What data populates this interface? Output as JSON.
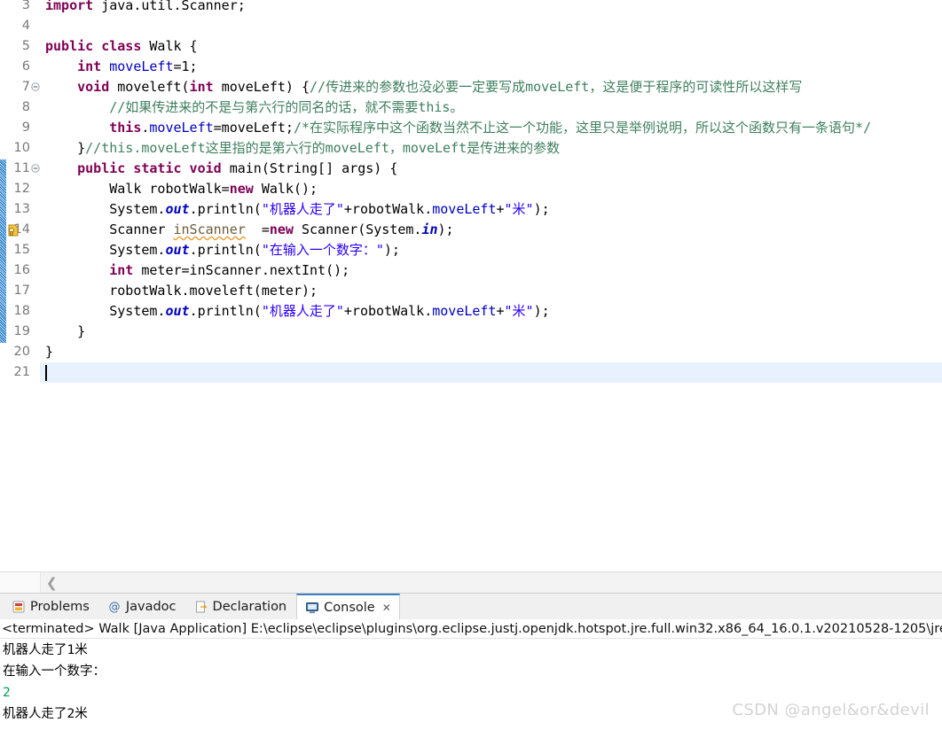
{
  "editor": {
    "first_visible_line": 3,
    "current_line": 21,
    "change_bar": {
      "from_line": 11,
      "to_line": 19,
      "color": "#3a8fd0"
    },
    "warning_marker_line": 14,
    "fold_lines": [
      7,
      11
    ],
    "bottom_scroll_icon": "chevron-left-icon",
    "lines": [
      {
        "n": 3,
        "tokens": [
          {
            "t": "import ",
            "c": "kw"
          },
          {
            "t": "java.util.Scanner;",
            "c": "pln"
          }
        ]
      },
      {
        "n": 4,
        "tokens": []
      },
      {
        "n": 5,
        "tokens": [
          {
            "t": "public class ",
            "c": "kw"
          },
          {
            "t": "Walk {",
            "c": "pln"
          }
        ]
      },
      {
        "n": 6,
        "tokens": [
          {
            "t": "    ",
            "c": "pln"
          },
          {
            "t": "int ",
            "c": "kw"
          },
          {
            "t": "moveLeft",
            "c": "fld"
          },
          {
            "t": "=1;",
            "c": "pln"
          }
        ]
      },
      {
        "n": 7,
        "tokens": [
          {
            "t": "    ",
            "c": "pln"
          },
          {
            "t": "void ",
            "c": "kw"
          },
          {
            "t": "moveleft(",
            "c": "pln"
          },
          {
            "t": "int ",
            "c": "kw"
          },
          {
            "t": "moveLeft) {",
            "c": "pln"
          },
          {
            "t": "//传进来的参数也没必要一定要写成moveLeft，这是便于程序的可读性所以这样写",
            "c": "cmt"
          }
        ]
      },
      {
        "n": 8,
        "tokens": [
          {
            "t": "        ",
            "c": "pln"
          },
          {
            "t": "//如果传进来的不是与第六行的同名的话，就不需要this。",
            "c": "cmt"
          }
        ]
      },
      {
        "n": 9,
        "tokens": [
          {
            "t": "        ",
            "c": "pln"
          },
          {
            "t": "this",
            "c": "kw"
          },
          {
            "t": ".",
            "c": "pln"
          },
          {
            "t": "moveLeft",
            "c": "fld"
          },
          {
            "t": "=moveLeft;",
            "c": "pln"
          },
          {
            "t": "/*在实际程序中这个函数当然不止这一个功能，这里只是举例说明，所以这个函数只有一条语句*/",
            "c": "cmt"
          }
        ]
      },
      {
        "n": 10,
        "tokens": [
          {
            "t": "    }",
            "c": "pln"
          },
          {
            "t": "//this.moveLeft这里指的是第六行的moveLeft，moveLeft是传进来的参数",
            "c": "cmt"
          }
        ]
      },
      {
        "n": 11,
        "tokens": [
          {
            "t": "    ",
            "c": "pln"
          },
          {
            "t": "public static void ",
            "c": "kw"
          },
          {
            "t": "main(String[] args) {",
            "c": "pln"
          }
        ]
      },
      {
        "n": 12,
        "tokens": [
          {
            "t": "        Walk robotWalk=",
            "c": "pln"
          },
          {
            "t": "new ",
            "c": "kw"
          },
          {
            "t": "Walk();",
            "c": "pln"
          }
        ]
      },
      {
        "n": 13,
        "tokens": [
          {
            "t": "        System.",
            "c": "pln"
          },
          {
            "t": "out",
            "c": "sfld"
          },
          {
            "t": ".println(",
            "c": "pln"
          },
          {
            "t": "\"机器人走了\"",
            "c": "str"
          },
          {
            "t": "+robotWalk.",
            "c": "pln"
          },
          {
            "t": "moveLeft",
            "c": "fld"
          },
          {
            "t": "+",
            "c": "pln"
          },
          {
            "t": "\"米\"",
            "c": "str"
          },
          {
            "t": ");",
            "c": "pln"
          }
        ]
      },
      {
        "n": 14,
        "tokens": [
          {
            "t": "        Scanner ",
            "c": "pln"
          },
          {
            "t": "inScanner",
            "c": "warnu"
          },
          {
            "t": "  =",
            "c": "pln"
          },
          {
            "t": "new ",
            "c": "kw"
          },
          {
            "t": "Scanner(System.",
            "c": "pln"
          },
          {
            "t": "in",
            "c": "sfld"
          },
          {
            "t": ");",
            "c": "pln"
          }
        ]
      },
      {
        "n": 15,
        "tokens": [
          {
            "t": "        System.",
            "c": "pln"
          },
          {
            "t": "out",
            "c": "sfld"
          },
          {
            "t": ".println(",
            "c": "pln"
          },
          {
            "t": "\"在输入一个数字：\"",
            "c": "str"
          },
          {
            "t": ");",
            "c": "pln"
          }
        ]
      },
      {
        "n": 16,
        "tokens": [
          {
            "t": "        ",
            "c": "pln"
          },
          {
            "t": "int ",
            "c": "kw"
          },
          {
            "t": "meter=inScanner.nextInt();",
            "c": "pln"
          }
        ]
      },
      {
        "n": 17,
        "tokens": [
          {
            "t": "        robotWalk.moveleft(meter);",
            "c": "pln"
          }
        ]
      },
      {
        "n": 18,
        "tokens": [
          {
            "t": "        System.",
            "c": "pln"
          },
          {
            "t": "out",
            "c": "sfld"
          },
          {
            "t": ".println(",
            "c": "pln"
          },
          {
            "t": "\"机器人走了\"",
            "c": "str"
          },
          {
            "t": "+robotWalk.",
            "c": "pln"
          },
          {
            "t": "moveLeft",
            "c": "fld"
          },
          {
            "t": "+",
            "c": "pln"
          },
          {
            "t": "\"米\"",
            "c": "str"
          },
          {
            "t": ");",
            "c": "pln"
          }
        ]
      },
      {
        "n": 19,
        "tokens": [
          {
            "t": "    }",
            "c": "pln"
          }
        ]
      },
      {
        "n": 20,
        "tokens": [
          {
            "t": "}",
            "c": "pln"
          }
        ]
      },
      {
        "n": 21,
        "tokens": []
      }
    ]
  },
  "bottom_panel": {
    "tabs": [
      {
        "label": "Problems",
        "icon": "problems-icon",
        "active": false,
        "closable": false
      },
      {
        "label": "Javadoc",
        "icon": "javadoc-icon",
        "active": false,
        "closable": false
      },
      {
        "label": "Declaration",
        "icon": "declaration-icon",
        "active": false,
        "closable": false
      },
      {
        "label": "Console",
        "icon": "console-icon",
        "active": true,
        "closable": true
      }
    ],
    "close_glyph": "✕",
    "launch_line": "<terminated> Walk [Java Application] E:\\eclipse\\eclipse\\plugins\\org.eclipse.justj.openjdk.hotspot.jre.full.win32.x86_64_16.0.1.v20210528-1205\\jre",
    "output": [
      {
        "text": "机器人走了1米",
        "kind": "stdout"
      },
      {
        "text": "在输入一个数字：",
        "kind": "stdout"
      },
      {
        "text": "2",
        "kind": "stdin"
      },
      {
        "text": "机器人走了2米",
        "kind": "stdout"
      }
    ],
    "colors": {
      "stdout": "#000000",
      "stdin": "#00a050"
    }
  },
  "watermark": "CSDN @angel&or&devil"
}
